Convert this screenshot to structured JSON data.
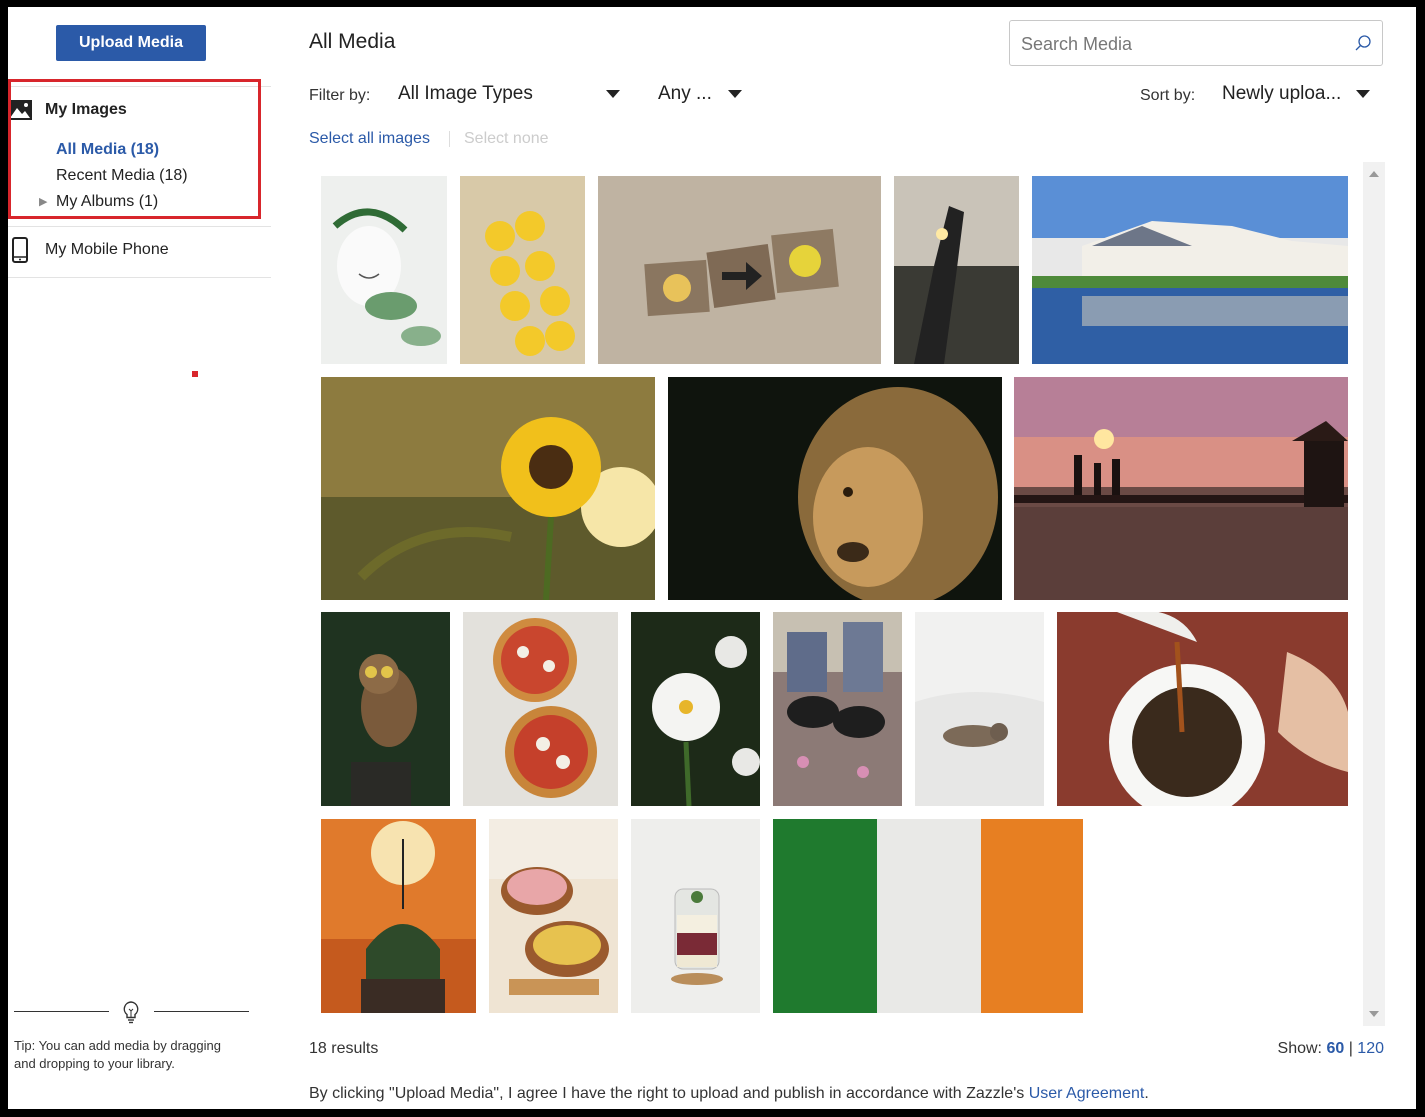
{
  "sidebar": {
    "upload_label": "Upload Media",
    "my_images_label": "My Images",
    "all_media_label": "All Media (18)",
    "recent_media_label": "Recent Media (18)",
    "my_albums_label": "My Albums (1)",
    "mobile_label": "My Mobile Phone",
    "tip": "Tip: You can add media by dragging and dropping to your library.",
    "icons": [
      "image-icon",
      "mobile-phone-icon",
      "expand-triangle-icon",
      "lightbulb-icon"
    ]
  },
  "header": {
    "title": "All Media",
    "search_placeholder": "Search Media",
    "search_icon": "search-icon"
  },
  "filters": {
    "filter_label": "Filter by:",
    "type_value": "All Image Types",
    "date_value": "Any ...",
    "sort_label": "Sort by:",
    "sort_value": "Newly uploa...",
    "select_all": "Select all images",
    "select_none": "Select none"
  },
  "gallery": {
    "images": [
      "egg-with-leaf-crown",
      "emoji-balls-in-tray",
      "wooden-blocks-on-sand",
      "hand-holding-sun",
      "waterfront-houses",
      "sunflower-at-sunset",
      "lion-portrait",
      "family-on-pier-sunset",
      "owl-on-stump",
      "two-pizzas",
      "white-daffodil",
      "sneakers-on-petals",
      "cat-on-bed",
      "pouring-tea",
      "dome-at-sunset",
      "smoothie-bowls",
      "parfait-jar",
      "irish-flag"
    ]
  },
  "footer": {
    "results": "18 results",
    "show_label": "Show:",
    "show_60": "60",
    "show_120": "120",
    "agree_prefix": "By clicking \"Upload Media\", I agree I have the right to upload and publish in accordance with Zazzle's ",
    "agree_link": "User Agreement",
    "agree_suffix": "."
  },
  "colors": {
    "accent": "#2b5aa8",
    "highlight": "#d8262c"
  }
}
